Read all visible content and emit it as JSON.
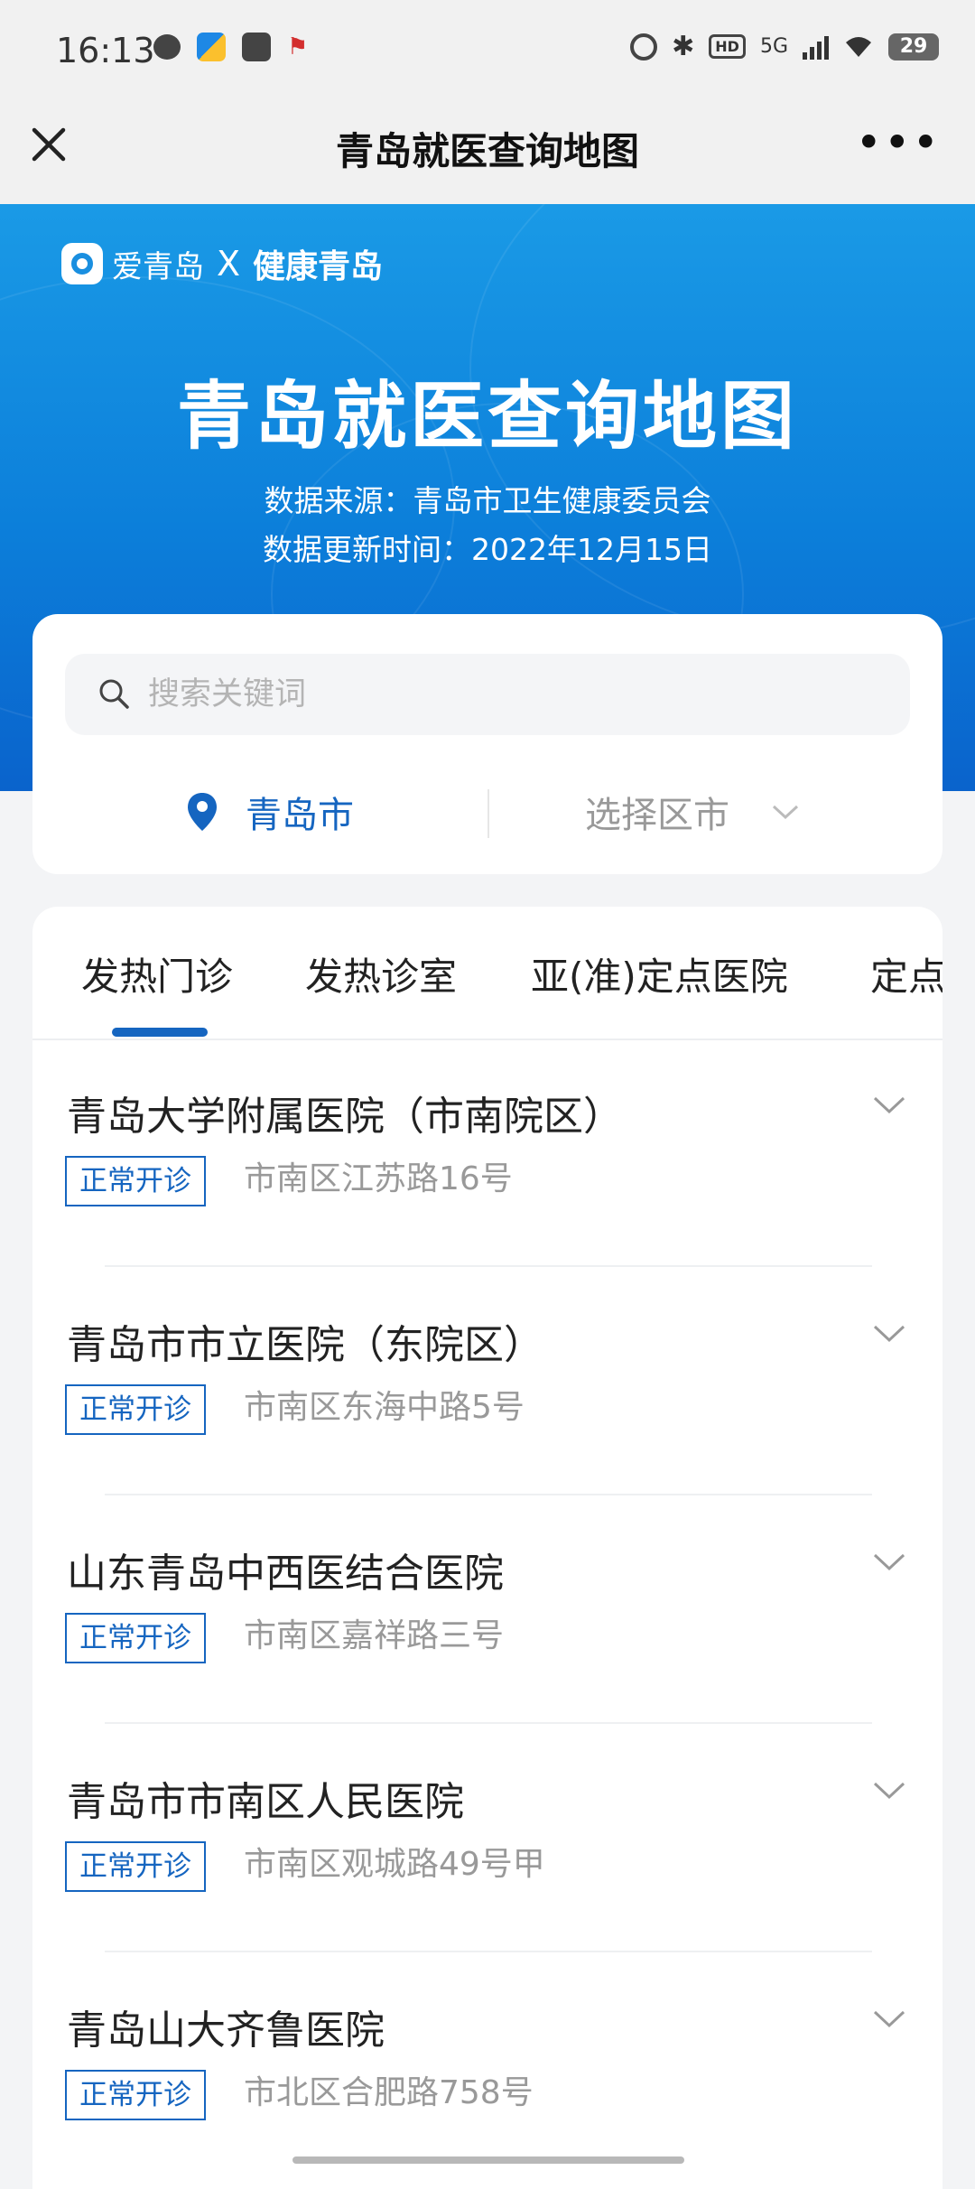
{
  "status_bar": {
    "time": "16:13",
    "network": "5G",
    "hd": "HD",
    "battery": "29"
  },
  "nav": {
    "title": "青岛就医查询地图",
    "more": "•••"
  },
  "hero": {
    "brand_a": "爱青岛",
    "brand_x": "X",
    "brand_b": "健康青岛",
    "title": "青岛就医查询地图",
    "source": "数据来源：青岛市卫生健康委员会",
    "update_time": "数据更新时间：2022年12月15日"
  },
  "search": {
    "placeholder": "搜索关键词",
    "city": "青岛市",
    "district_placeholder": "选择区市"
  },
  "tabs": [
    {
      "label": "发热门诊",
      "active": true
    },
    {
      "label": "发热诊室",
      "active": false
    },
    {
      "label": "亚(准)定点医院",
      "active": false
    },
    {
      "label": "定点",
      "active": false
    }
  ],
  "hospitals": [
    {
      "name": "青岛大学附属医院（市南院区）",
      "status": "正常开诊",
      "address": "市南区江苏路16号"
    },
    {
      "name": "青岛市市立医院（东院区）",
      "status": "正常开诊",
      "address": "市南区东海中路5号"
    },
    {
      "name": "山东青岛中西医结合医院",
      "status": "正常开诊",
      "address": "市南区嘉祥路三号"
    },
    {
      "name": "青岛市市南区人民医院",
      "status": "正常开诊",
      "address": "市南区观城路49号甲"
    },
    {
      "name": "青岛山大齐鲁医院",
      "status": "正常开诊",
      "address": "市北区合肥路758号"
    }
  ],
  "colors": {
    "primary": "#1565c0",
    "hero_top": "#1a9ae6",
    "hero_bottom": "#0a63cc"
  }
}
